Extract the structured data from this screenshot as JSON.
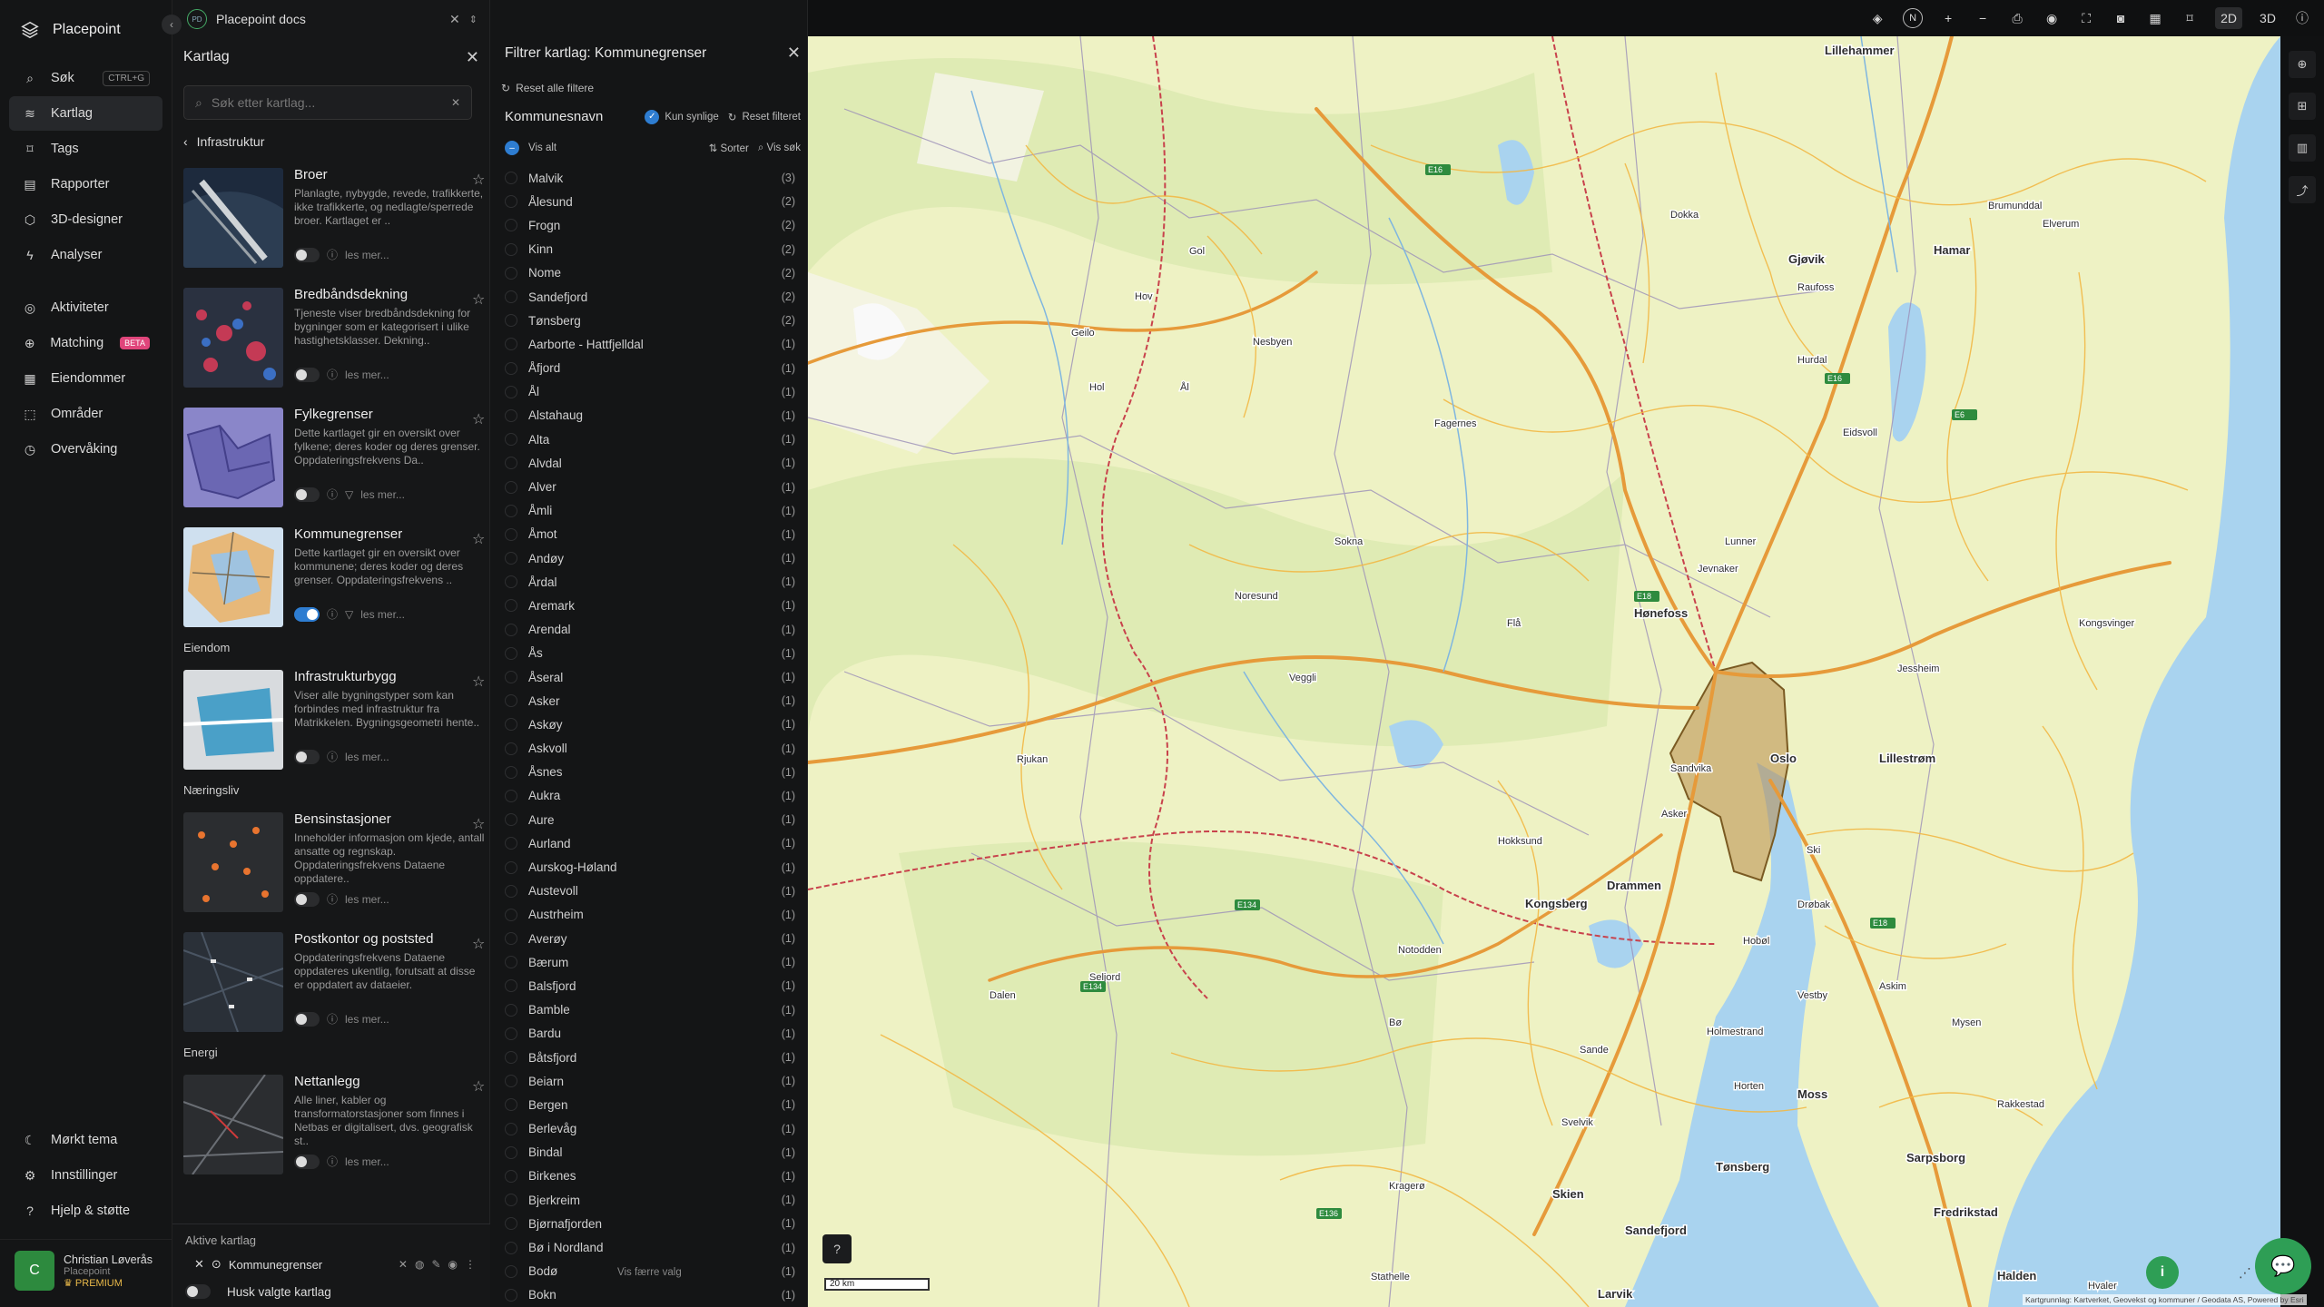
{
  "app": {
    "brand": "Placepoint",
    "doc_tab": "Placepoint docs"
  },
  "nav": {
    "items": [
      {
        "label": "Søk",
        "shortcut": "CTRL+G"
      },
      {
        "label": "Kartlag"
      },
      {
        "label": "Tags"
      },
      {
        "label": "Rapporter"
      },
      {
        "label": "3D-designer"
      },
      {
        "label": "Analyser"
      },
      {
        "label": "Aktiviteter"
      },
      {
        "label": "Matching",
        "badge": "BETA"
      },
      {
        "label": "Eiendommer"
      },
      {
        "label": "Områder"
      },
      {
        "label": "Overvåking"
      }
    ],
    "bottom": [
      {
        "label": "Mørkt tema"
      },
      {
        "label": "Innstillinger"
      },
      {
        "label": "Hjelp & støtte"
      }
    ],
    "user": {
      "initial": "C",
      "name": "Christian Løverås",
      "org": "Placepoint",
      "plan": "PREMIUM"
    }
  },
  "layers": {
    "title": "Kartlag",
    "search_placeholder": "Søk etter kartlag...",
    "breadcrumb": "Infrastruktur",
    "read_more": "les mer...",
    "sections": [
      {
        "name": "",
        "items": [
          {
            "title": "Broer",
            "desc": "Planlagte, nybygde, revede, trafikkerte, ikke trafikkerte, og nedlagte/sperrede broer. Kartlaget er ..",
            "on": false
          },
          {
            "title": "Bredbåndsdekning",
            "desc": "Tjeneste viser bredbåndsdekning for bygninger som er kategorisert i ulike hastighetsklasser. Dekning..",
            "on": false
          },
          {
            "title": "Fylkegrenser",
            "desc": "Dette kartlaget gir en oversikt over fylkene; deres koder og deres grenser. Oppdateringsfrekvens Da..",
            "on": false
          },
          {
            "title": "Kommunegrenser",
            "desc": "Dette kartlaget gir en oversikt over kommunene; deres koder og deres grenser. Oppdateringsfrekvens ..",
            "on": true
          }
        ]
      },
      {
        "name": "Eiendom",
        "items": [
          {
            "title": "Infrastrukturbygg",
            "desc": "Viser alle bygningstyper som kan forbindes med infrastruktur fra Matrikkelen. Bygningsgeometri hente..",
            "on": false
          }
        ]
      },
      {
        "name": "Næringsliv",
        "items": [
          {
            "title": "Bensinstasjoner",
            "desc": "Inneholder informasjon om kjede, antall ansatte og regnskap. Oppdateringsfrekvens Dataene oppdatere..",
            "on": false
          },
          {
            "title": "Postkontor og poststed",
            "desc": "Oppdateringsfrekvens Dataene oppdateres ukentlig, forutsatt at disse er oppdatert av dataeier.",
            "on": false
          }
        ]
      },
      {
        "name": "Energi",
        "items": [
          {
            "title": "Nettanlegg",
            "desc": "Alle liner, kabler og transformatorstasjoner som finnes i Netbas er digitalisert, dvs. geografisk st..",
            "on": false
          }
        ]
      }
    ],
    "active_label": "Aktive kartlag",
    "active_layer": "Kommunegrenser",
    "remember": "Husk valgte kartlag"
  },
  "filter": {
    "title": "Filtrer kartlag: Kommunegrenser",
    "reset_all": "Reset alle filtere",
    "column": "Kommunesnavn",
    "only_visible": "Kun synlige",
    "reset_filter": "Reset filteret",
    "show_all": "Vis alt",
    "sort": "Sorter",
    "show_search": "Vis søk",
    "show_fewer": "Vis færre valg",
    "rows": [
      [
        "Malvik",
        "(3)"
      ],
      [
        "Ålesund",
        "(2)"
      ],
      [
        "Frogn",
        "(2)"
      ],
      [
        "Kinn",
        "(2)"
      ],
      [
        "Nome",
        "(2)"
      ],
      [
        "Sandefjord",
        "(2)"
      ],
      [
        "Tønsberg",
        "(2)"
      ],
      [
        "Aarborte - Hattfjelldal",
        "(1)"
      ],
      [
        "Åfjord",
        "(1)"
      ],
      [
        "Ål",
        "(1)"
      ],
      [
        "Alstahaug",
        "(1)"
      ],
      [
        "Alta",
        "(1)"
      ],
      [
        "Alvdal",
        "(1)"
      ],
      [
        "Alver",
        "(1)"
      ],
      [
        "Åmli",
        "(1)"
      ],
      [
        "Åmot",
        "(1)"
      ],
      [
        "Andøy",
        "(1)"
      ],
      [
        "Årdal",
        "(1)"
      ],
      [
        "Aremark",
        "(1)"
      ],
      [
        "Arendal",
        "(1)"
      ],
      [
        "Ås",
        "(1)"
      ],
      [
        "Åseral",
        "(1)"
      ],
      [
        "Asker",
        "(1)"
      ],
      [
        "Askøy",
        "(1)"
      ],
      [
        "Askvoll",
        "(1)"
      ],
      [
        "Åsnes",
        "(1)"
      ],
      [
        "Aukra",
        "(1)"
      ],
      [
        "Aure",
        "(1)"
      ],
      [
        "Aurland",
        "(1)"
      ],
      [
        "Aurskog-Høland",
        "(1)"
      ],
      [
        "Austevoll",
        "(1)"
      ],
      [
        "Austrheim",
        "(1)"
      ],
      [
        "Averøy",
        "(1)"
      ],
      [
        "Bærum",
        "(1)"
      ],
      [
        "Balsfjord",
        "(1)"
      ],
      [
        "Bamble",
        "(1)"
      ],
      [
        "Bardu",
        "(1)"
      ],
      [
        "Båtsfjord",
        "(1)"
      ],
      [
        "Beiarn",
        "(1)"
      ],
      [
        "Bergen",
        "(1)"
      ],
      [
        "Berlevåg",
        "(1)"
      ],
      [
        "Bindal",
        "(1)"
      ],
      [
        "Birkenes",
        "(1)"
      ],
      [
        "Bjerkreim",
        "(1)"
      ],
      [
        "Bjørnafjorden",
        "(1)"
      ],
      [
        "Bø i Nordland",
        "(1)"
      ],
      [
        "Bodø",
        "(1)"
      ],
      [
        "Bokn",
        "(1)"
      ]
    ]
  },
  "map": {
    "toolbar": [
      "2D",
      "3D"
    ],
    "scale": "20 km",
    "attribution": "Kartgrunnlag: Kartverket, Geovekst og kommuner / Geodata AS, Powered by Esri",
    "places": [
      "Lillehammer",
      "Gjøvik",
      "Hamar",
      "Elverum",
      "Brumunddal",
      "Raufoss",
      "Lunner",
      "Jevnaker",
      "Hønefoss",
      "Oslo",
      "Lillestrøm",
      "Sandvika",
      "Drammen",
      "Kongsberg",
      "Hokksund",
      "Notodden",
      "Holmestrand",
      "Horten",
      "Moss",
      "Tønsberg",
      "Sandefjord",
      "Skien",
      "Sarpsborg",
      "Fredrikstad",
      "Halden",
      "Askim",
      "Mysen",
      "Ski",
      "Drøbak",
      "Asker",
      "Jessheim",
      "Kongsvinger",
      "Geilo",
      "Gol",
      "Nesbyen",
      "Rjukan",
      "Seljord",
      "Larvik",
      "Stathelle",
      "Kragerø",
      "Hvaler",
      "Rakkestad",
      "Eidsvoll",
      "Hurdal",
      "Dokka",
      "Fagernes",
      "Hov",
      "Sokna",
      "Noresund",
      "Veggli",
      "Flå",
      "Hol",
      "Ål",
      "Dalen",
      "Bø",
      "Svelvik",
      "Sande",
      "Hobøl",
      "Vestby"
    ],
    "roads": [
      "E16",
      "E134",
      "E18",
      "E6",
      "E136"
    ]
  }
}
